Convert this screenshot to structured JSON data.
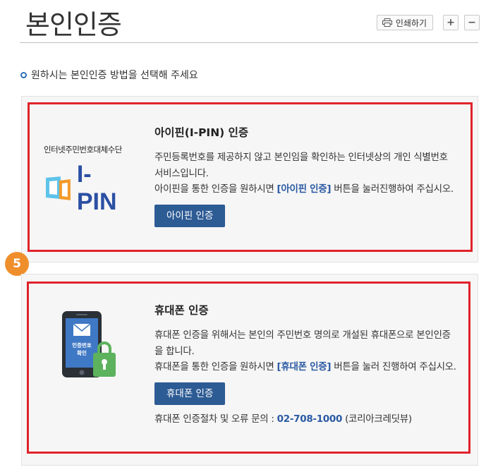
{
  "page": {
    "title": "본인인증",
    "instruction": "원하시는 본인인증 방법을 선택해 주세요"
  },
  "toolbar": {
    "print_label": "인쇄하기",
    "zoom_in": "+",
    "zoom_out": "−"
  },
  "ipin": {
    "logo_caption": "인터넷주민번호대체수단",
    "logo_text": "I-PIN",
    "heading": "아이핀(I-PIN) 인증",
    "desc1": "주민등록번호를 제공하지 않고 본인임을 확인하는 인터넷상의 개인 식별번호 서비스입니다.",
    "desc2_prefix": "아이핀을 통한 인증을 원하시면 ",
    "desc2_link": "[아이핀 인증]",
    "desc2_suffix": " 버튼을 눌러진행하여 주십시오.",
    "button": "아이핀 인증"
  },
  "phone": {
    "icon_label_line1": "인증번호",
    "icon_label_line2": "확인",
    "heading": "휴대폰 인증",
    "desc1": "휴대폰 인증을 위해서는 본인의 주민번호 명의로 개설된 휴대폰으로 본인인증을 합니다.",
    "desc2_prefix": "휴대폰을 통한 인증을 원하시면 ",
    "desc2_link": "[휴대폰 인증]",
    "desc2_suffix": " 버튼을 눌러 진행하여 주십시오.",
    "button": "휴대폰 인증",
    "contact_prefix": "휴대폰 인증절차 및 오류 문의 : ",
    "contact_tel": "02-708-1000",
    "contact_suffix": " (코리아크레딧뷰)"
  },
  "step_badge": "5",
  "colors": {
    "highlight": "#e0232b",
    "button": "#2d5b94",
    "badge": "#ef8f2c",
    "link": "#2b5aa3"
  }
}
